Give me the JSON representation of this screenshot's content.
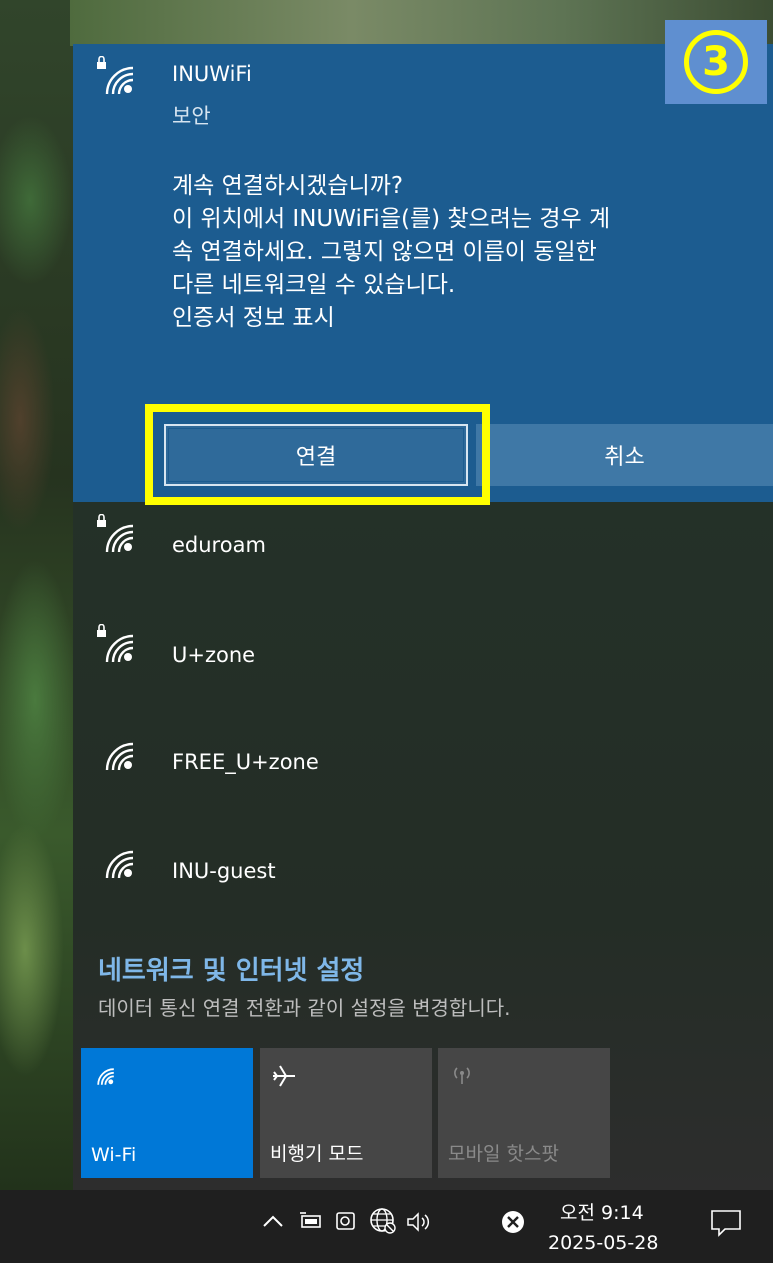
{
  "selected_network": {
    "name": "INUWiFi",
    "security": "보안",
    "prompt_lines": [
      "계속 연결하시겠습니까?",
      "이 위치에서 INUWiFi을(를) 찾으려는 경우 계",
      "속 연결하세요. 그렇지 않으면 이름이 동일한",
      "다른 네트워크일 수 있습니다.",
      "인증서 정보 표시"
    ],
    "connect_label": "연결",
    "cancel_label": "취소"
  },
  "step_marker": "3",
  "networks": [
    {
      "name": "eduroam",
      "secured": true
    },
    {
      "name": "U+zone",
      "secured": true
    },
    {
      "name": "FREE_U+zone",
      "secured": false
    },
    {
      "name": "INU-guest",
      "secured": false
    }
  ],
  "settings": {
    "title": "네트워크 및 인터넷 설정",
    "subtitle": "데이터 통신 연결 전환과 같이 설정을 변경합니다."
  },
  "quick_actions": [
    {
      "label": "Wi-Fi",
      "icon": "wifi-icon",
      "state": "on"
    },
    {
      "label": "비행기 모드",
      "icon": "airplane-icon",
      "state": "off"
    },
    {
      "label": "모바일 핫스팟",
      "icon": "hotspot-icon",
      "state": "disabled"
    }
  ],
  "taskbar": {
    "time": "오전 9:14",
    "date": "2025-05-28"
  },
  "colors": {
    "selected_panel": "#1c5c90",
    "wifi_tile_active": "#0078d7",
    "highlight": "#ffff00",
    "settings_link": "#7fb7e8"
  }
}
